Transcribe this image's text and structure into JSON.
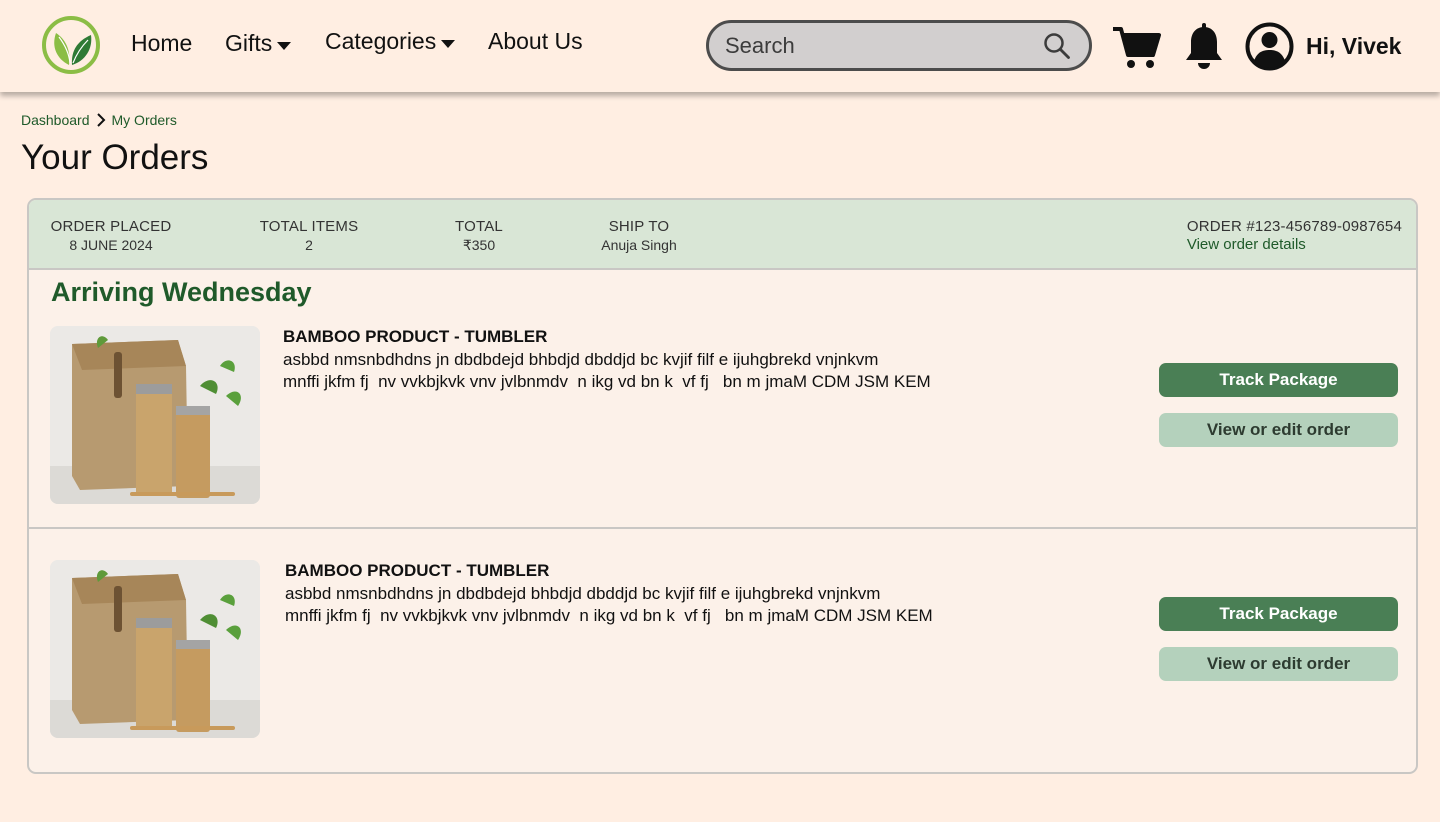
{
  "header": {
    "nav": {
      "home": "Home",
      "gifts": "Gifts",
      "categories": "Categories",
      "about": "About Us"
    },
    "search": {
      "placeholder": "Search"
    },
    "greeting": "Hi, Vivek",
    "icons": [
      "leaf-logo",
      "search-icon",
      "cart-icon",
      "bell-icon",
      "user-icon"
    ],
    "colors": {
      "background": "#ffeee2",
      "accent": "#1f5a2a"
    }
  },
  "breadcrumb": {
    "root": "Dashboard",
    "current": "My Orders"
  },
  "page_title": "Your Orders",
  "order": {
    "meta": {
      "placed_label": "ORDER PLACED",
      "placed_value": "8 JUNE 2024",
      "items_label": "TOTAL ITEMS",
      "items_value": "2",
      "total_label": "TOTAL",
      "total_value": "₹350",
      "ship_label": "SHIP TO",
      "ship_value": "Anuja Singh",
      "order_number": "ORDER #123-456789-0987654",
      "details_link": "View order details"
    },
    "status": "Arriving Wednesday",
    "items": [
      {
        "title": "BAMBOO PRODUCT - TUMBLER",
        "desc_line1": "asbbd nmsnbdhdns jn dbdbdejd bhbdjd dbddjd bc kvjif filf e ijuhgbrekd vnjnkvm",
        "desc_line2": "mnffi jkfm fj  nv vvkbjkvk vnv jvlbnmdv  n ikg vd bn k  vf fj   bn m jmaM CDM JSM KEM",
        "track_label": "Track Package",
        "view_label": "View or edit order"
      },
      {
        "title": "BAMBOO PRODUCT - TUMBLER",
        "desc_line1": "asbbd nmsnbdhdns jn dbdbdejd bhbdjd dbddjd bc kvjif filf e ijuhgbrekd vnjnkvm",
        "desc_line2": "mnffi jkfm fj  nv vvkbjkvk vnv jvlbnmdv  n ikg vd bn k  vf fj   bn m jmaM CDM JSM KEM",
        "track_label": "Track Package",
        "view_label": "View or edit order"
      }
    ]
  }
}
